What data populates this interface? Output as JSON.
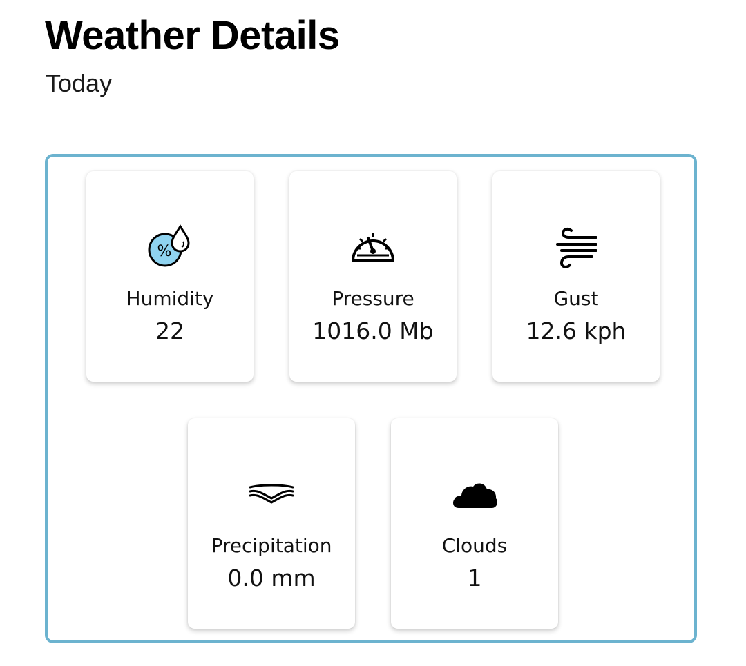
{
  "header": {
    "title": "Weather Details",
    "subtitle": "Today"
  },
  "details": [
    {
      "label": "Humidity",
      "value": "22",
      "icon": "humidity-icon"
    },
    {
      "label": "Pressure",
      "value": "1016.0 Mb",
      "icon": "pressure-gauge-icon"
    },
    {
      "label": "Gust",
      "value": "12.6 kph",
      "icon": "wind-icon"
    },
    {
      "label": "Precipitation",
      "value": "0.0 mm",
      "icon": "precipitation-icon"
    },
    {
      "label": "Clouds",
      "value": "1",
      "icon": "cloud-icon"
    }
  ],
  "colors": {
    "panel_border": "#6cb3cf",
    "humidity_icon_fill": "#8fd3f0"
  }
}
